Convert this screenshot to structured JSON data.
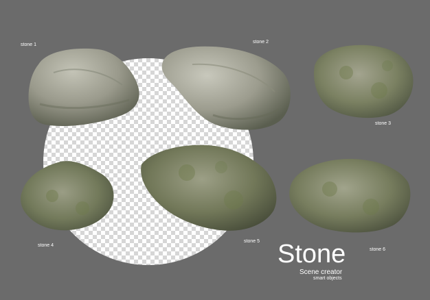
{
  "scene": {
    "title": "Stone",
    "subtitle": "Scene creator",
    "tagline": "smart objects"
  },
  "stones": [
    {
      "label": "stone 1"
    },
    {
      "label": "stone 2"
    },
    {
      "label": "stone 3"
    },
    {
      "label": "stone 4"
    },
    {
      "label": "stone 5"
    },
    {
      "label": "stone 6"
    }
  ],
  "colors": {
    "background": "#6b6b6b",
    "rock_light": "#a8a89a",
    "rock_mid": "#7d7f6d",
    "rock_dark": "#4f5344",
    "moss": "#6e7a4c"
  }
}
